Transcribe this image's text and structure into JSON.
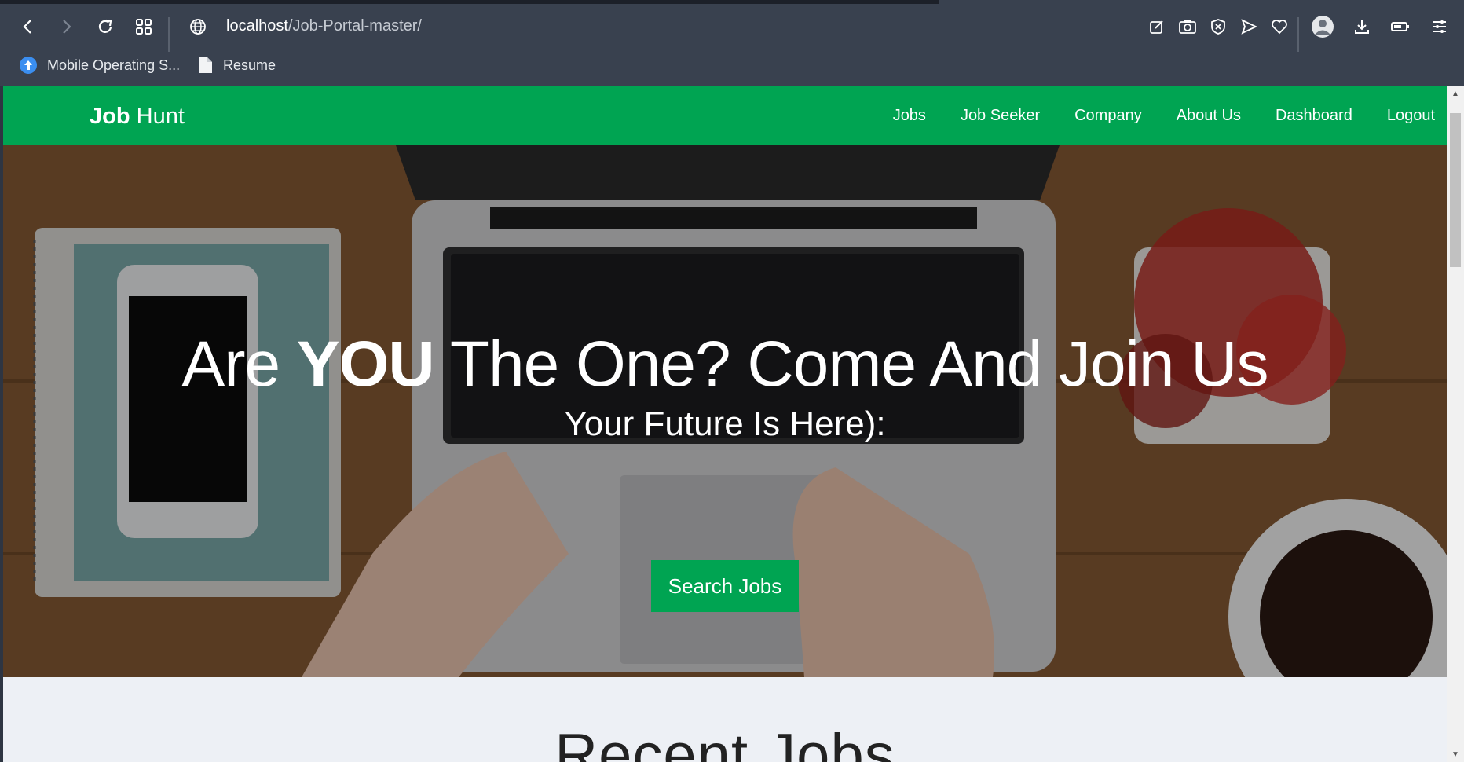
{
  "browser": {
    "url_host": "localhost",
    "url_path": "/Job-Portal-master/",
    "bookmarks": [
      {
        "label": "Mobile Operating S...",
        "icon": "upload-circle-icon"
      },
      {
        "label": "Resume",
        "icon": "document-icon"
      }
    ]
  },
  "navbar": {
    "brand_bold": "Job",
    "brand_rest": "Hunt",
    "links": [
      "Jobs",
      "Job Seeker",
      "Company",
      "About Us",
      "Dashboard",
      "Logout"
    ]
  },
  "hero": {
    "title_pre": "Are",
    "title_bold": "YOU",
    "title_post": "The One? Come And Join Us",
    "subtitle": "Your Future Is Here):",
    "button": "Search Jobs"
  },
  "section": {
    "title": "Recent Jobs"
  },
  "colors": {
    "accent": "#00a452",
    "chrome": "#39414f"
  }
}
